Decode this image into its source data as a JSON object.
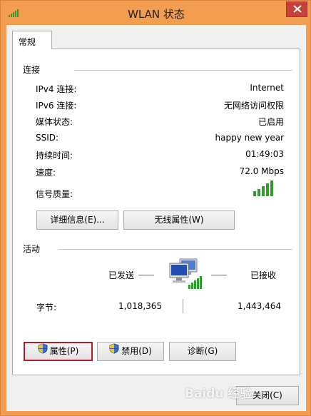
{
  "window": {
    "title": "WLAN 状态"
  },
  "tabs": [
    {
      "label": "常规"
    }
  ],
  "connection": {
    "header": "连接",
    "rows": [
      {
        "label": "IPv4 连接:",
        "value": "Internet"
      },
      {
        "label": "IPv6 连接:",
        "value": "无网络访问权限"
      },
      {
        "label": "媒体状态:",
        "value": "已启用"
      },
      {
        "label": "SSID:",
        "value": "happy new year"
      },
      {
        "label": "持续时间:",
        "value": "01:49:03"
      },
      {
        "label": "速度:",
        "value": "72.0 Mbps"
      }
    ],
    "signal_label": "信号质量:",
    "signal_bars": 5,
    "details_button": "详细信息(E)...",
    "wireless_button": "无线属性(W)"
  },
  "activity": {
    "header": "活动",
    "sent_label": "已发送",
    "received_label": "已接收",
    "bytes_label": "字节:",
    "bytes_sent": "1,018,365",
    "bytes_received": "1,443,464"
  },
  "buttons": {
    "properties": "属性(P)",
    "disable": "禁用(D)",
    "diagnose": "诊断(G)",
    "close": "关闭(C)"
  },
  "watermark": {
    "text": "Baidu 经验"
  },
  "colors": {
    "frame": "#f29d50",
    "close_button": "#c7403a",
    "focus_border": "#b31c22",
    "signal_green": "#2f9e2f"
  },
  "icons": {
    "app": "wifi-signal-icon",
    "network": "network-computers-icon",
    "shield": "uac-shield-icon"
  }
}
